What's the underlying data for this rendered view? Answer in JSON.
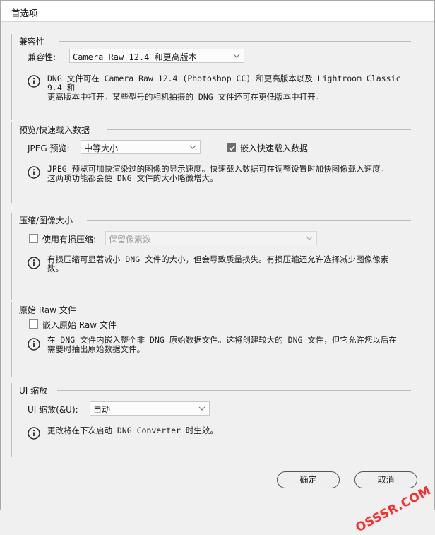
{
  "window": {
    "title": "首选项"
  },
  "compat": {
    "legend": "兼容性",
    "label": "兼容性:",
    "selected": "Camera Raw 12.4 和更高版本",
    "info": "DNG 文件可在 Camera Raw 12.4 (Photoshop CC) 和更高版本以及 Lightroom Classic 9.4 和\n更高版本中打开。某些型号的相机拍摄的 DNG 文件还可在更低版本中打开。"
  },
  "preview": {
    "legend": "预览/快速载入数据",
    "jpeg_label": "JPEG 预览:",
    "jpeg_selected": "中等大小",
    "embed_label": "嵌入快速载入数据",
    "embed_checked": true,
    "info": "JPEG 预览可加快渲染过的图像的显示速度。快速载入数据可在调整设置时加快图像载入速度。\n这两项功能都会使 DNG 文件的大小略微增大。"
  },
  "compress": {
    "legend": "压缩/图像大小",
    "lossy_label": "使用有损压缩:",
    "lossy_checked": false,
    "lossy_selected": "保留像素数",
    "info": "有损压缩可显著减小 DNG 文件的大小，但会导致质量损失。有损压缩还允许选择减少图像像素\n数。"
  },
  "raw": {
    "legend": "原始 Raw 文件",
    "embed_label": "嵌入原始 Raw 文件",
    "embed_checked": false,
    "info": "在 DNG 文件内嵌入整个非 DNG 原始数据文件。这将创建较大的 DNG 文件，但它允许您以后在\n需要时抽出原始数据文件。"
  },
  "ui": {
    "legend": "UI 缩放",
    "label": "UI 缩放(&U):",
    "selected": "自动",
    "info": "更改将在下次启动 DNG Converter 时生效。"
  },
  "buttons": {
    "ok": "确定",
    "cancel": "取消"
  },
  "watermark": "OSSSR.COM",
  "colors": {
    "window_bg": "#f0f0f0",
    "border": "#bdbdbd",
    "watermark": "#ff2b2b"
  }
}
